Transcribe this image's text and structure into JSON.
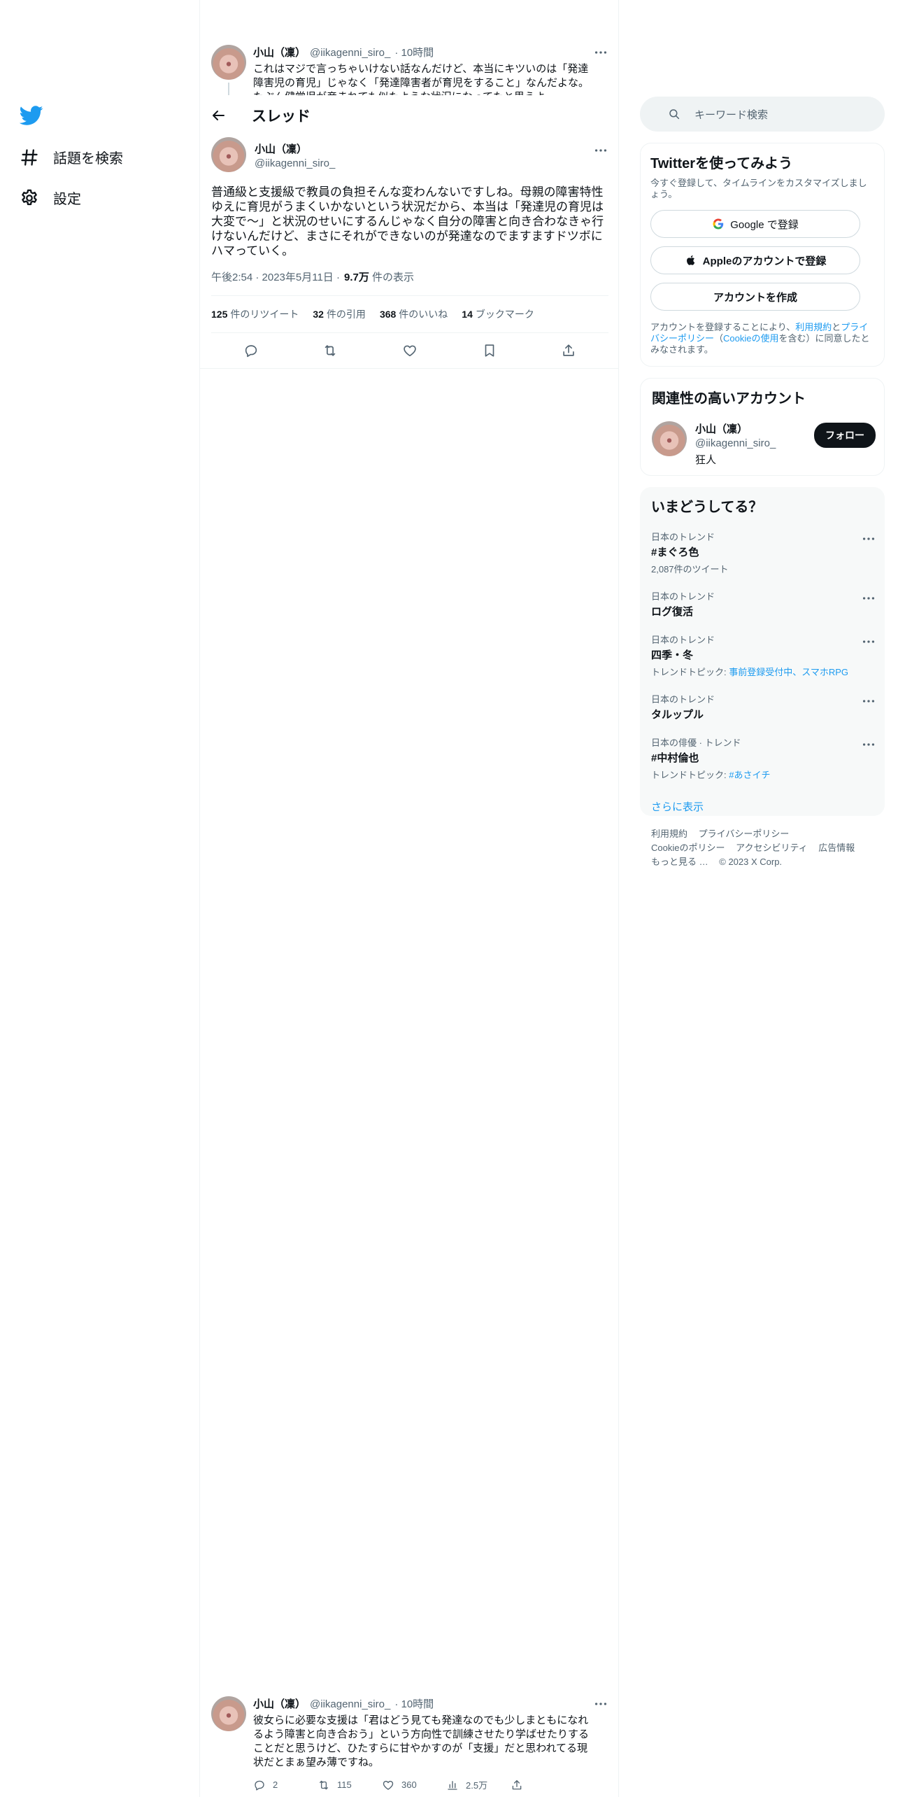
{
  "nav": {
    "explore_label": "話題を検索",
    "settings_label": "設定"
  },
  "prev_tweet": {
    "name": "小山（凜）",
    "handle": "@iikagenni_siro_",
    "time": "· 10時間",
    "text": "これはマジで言っちゃいけない話なんだけど、本当にキツいのは「発達障害児の育児」じゃなく「発達障害者が育児をすること」なんだよな。たぶん健常児が産まれても似たような状況になってたと思うよ。"
  },
  "thread_header": {
    "title": "スレッド"
  },
  "main_tweet": {
    "name": "小山（凜）",
    "handle": "@iikagenni_siro_",
    "text": "普通級と支援級で教員の負担そんな変わんないですしね。母親の障害特性ゆえに育児がうまくいかないという状況だから、本当は「発達児の育児は大変で〜」と状況のせいにするんじゃなく自分の障害と向き合わなきゃ行けないんだけど、まさにそれができないのが発達なのでますますドツボにハマっていく。",
    "time": "午後2:54 · 2023年5月11日 ·",
    "views_count": "9.7万",
    "views_label": "件の表示",
    "stats": [
      {
        "count": "125",
        "label": "件のリツイート"
      },
      {
        "count": "32",
        "label": "件の引用"
      },
      {
        "count": "368",
        "label": "件のいいね"
      },
      {
        "count": "14",
        "label": "ブックマーク"
      }
    ]
  },
  "reply_tweet": {
    "name": "小山（凜）",
    "handle": "@iikagenni_siro_",
    "time": "· 10時間",
    "text": "彼女らに必要な支援は「君はどう見ても発達なのでも少しまともになれるよう障害と向き合おう」という方向性で訓練させたり学ばせたりすることだと思うけど、ひたすらに甘やかすのが「支援」だと思われてる現状だとまぁ望み薄ですね。",
    "replies": "2",
    "retweets": "115",
    "likes": "360",
    "views": "2.5万"
  },
  "search": {
    "placeholder": "キーワード検索"
  },
  "signup": {
    "title": "Twitterを使ってみよう",
    "subtitle": "今すぐ登録して、タイムラインをカスタマイズしましょう。",
    "google_label": "Google で登録",
    "apple_label": "Appleのアカウントで登録",
    "create_label": "アカウントを作成",
    "legal_prefix": "アカウントを登録することにより、",
    "legal_terms": "利用規約",
    "legal_and": "と",
    "legal_privacy": "プライバシーポリシー",
    "legal_paren_open": "（",
    "legal_cookie": "Cookieの使用",
    "legal_suffix": "を含む）に同意したとみなされます。"
  },
  "related": {
    "title": "関連性の高いアカウント",
    "name": "小山（凜）",
    "handle": "@iikagenni_siro_",
    "bio": "狂人",
    "follow_label": "フォロー"
  },
  "trends": {
    "title": "いまどうしてる？",
    "items": [
      {
        "context": "日本のトレンド",
        "title": "#まぐろ色",
        "extra": "2,087件のツイート"
      },
      {
        "context": "日本のトレンド",
        "title": "ログ復活",
        "extra": ""
      },
      {
        "context": "日本のトレンド",
        "title": "四季・冬",
        "extra_prefix": "トレンドトピック: ",
        "extra_link": "事前登録受付中、スマホRPG"
      },
      {
        "context": "日本のトレンド",
        "title": "タルップル",
        "extra": ""
      },
      {
        "context": "日本の俳優 · トレンド",
        "title": "#中村倫也",
        "extra_prefix": "トレンドトピック: ",
        "extra_link": "#あさイチ"
      }
    ],
    "show_more": "さらに表示"
  },
  "footer": {
    "terms": "利用規約",
    "privacy": "プライバシーポリシー",
    "cookie": "Cookieのポリシー",
    "accessibility": "アクセシビリティ",
    "ads": "広告情報",
    "more": "もっと見る …",
    "copyright": "© 2023 X Corp."
  },
  "colors": {
    "accent": "#1d9bf0",
    "text": "#0f1419",
    "muted": "#536471",
    "border": "#eff3f4"
  }
}
